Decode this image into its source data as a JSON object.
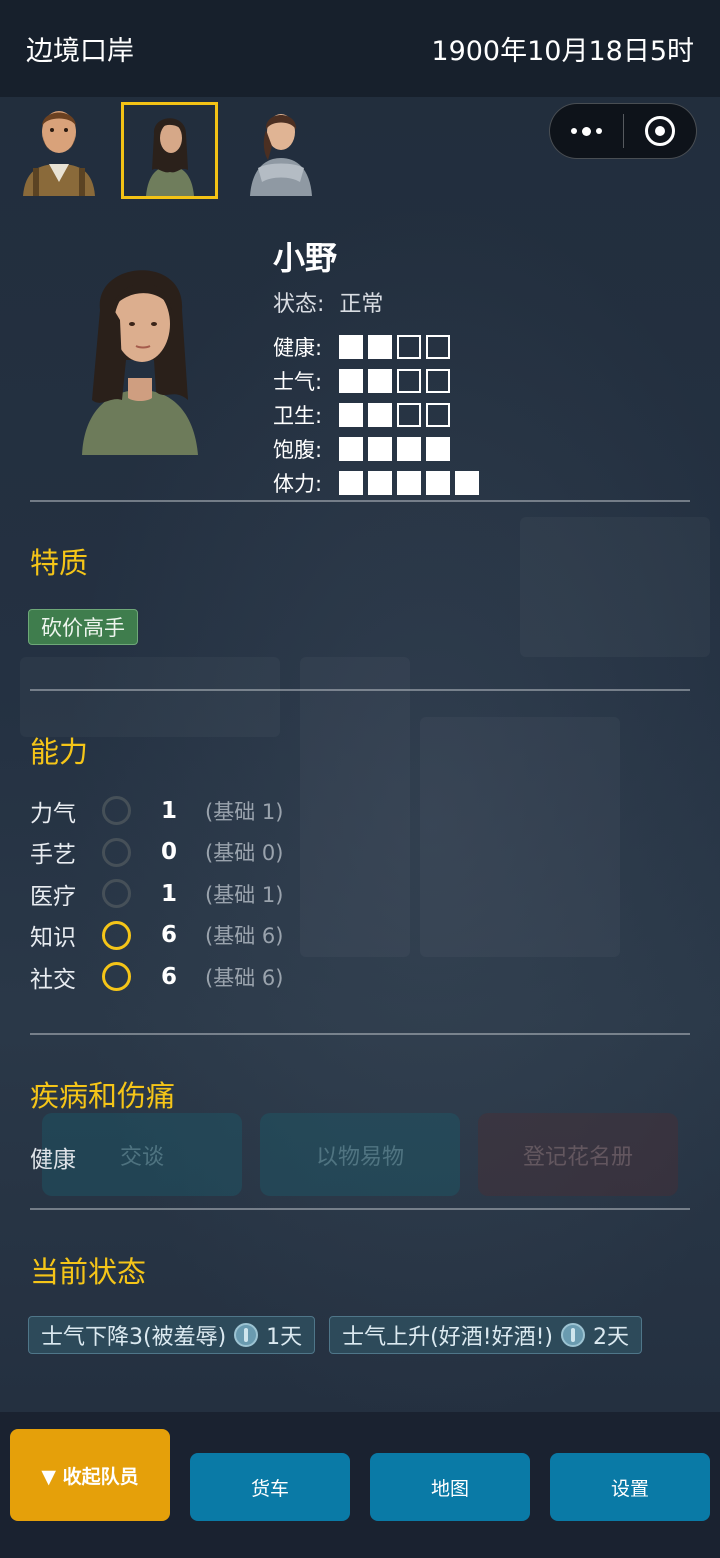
{
  "header": {
    "location": "边境口岸",
    "datetime": "1900年10月18日5时"
  },
  "portraits": [
    {
      "name": "bearded-man-portrait",
      "selected": false
    },
    {
      "name": "xiaoye-portrait",
      "selected": true
    },
    {
      "name": "scarf-woman-portrait",
      "selected": false
    }
  ],
  "character": {
    "name": "小野",
    "status_label": "状态:",
    "status_value": "正常",
    "stats": [
      {
        "label": "健康:",
        "value": 2,
        "max": 4
      },
      {
        "label": "士气:",
        "value": 2,
        "max": 4
      },
      {
        "label": "卫生:",
        "value": 2,
        "max": 4
      },
      {
        "label": "饱腹:",
        "value": 4,
        "max": 4
      },
      {
        "label": "体力:",
        "value": 5,
        "max": 5
      }
    ]
  },
  "sections": {
    "traits_title": "特质",
    "abilities_title": "能力",
    "disease_title": "疾病和伤痛",
    "current_title": "当前状态"
  },
  "traits": [
    "砍价高手"
  ],
  "abilities": [
    {
      "name": "力气",
      "value": "1",
      "base": "(基础 1)",
      "highlighted": false
    },
    {
      "name": "手艺",
      "value": "0",
      "base": "(基础 0)",
      "highlighted": false
    },
    {
      "name": "医疗",
      "value": "1",
      "base": "(基础 1)",
      "highlighted": false
    },
    {
      "name": "知识",
      "value": "6",
      "base": "(基础 6)",
      "highlighted": true
    },
    {
      "name": "社交",
      "value": "6",
      "base": "(基础 6)",
      "highlighted": true
    }
  ],
  "disease": {
    "text": "健康"
  },
  "background_buttons": [
    "交谈",
    "以物易物",
    "登记花名册"
  ],
  "effects": [
    {
      "text": "士气下降3(被羞辱)",
      "duration": "1天"
    },
    {
      "text": "士气上升(好酒!好酒!)",
      "duration": "2天"
    }
  ],
  "bottom_buttons": {
    "collapse": "▼ 收起队员",
    "truck": "货车",
    "map": "地图",
    "settings": "设置"
  },
  "colors": {
    "accent": "#f5c518",
    "trait_bg": "#3f7d4d",
    "button_blue": "#0a7aa6",
    "button_orange": "#e5a00a"
  }
}
